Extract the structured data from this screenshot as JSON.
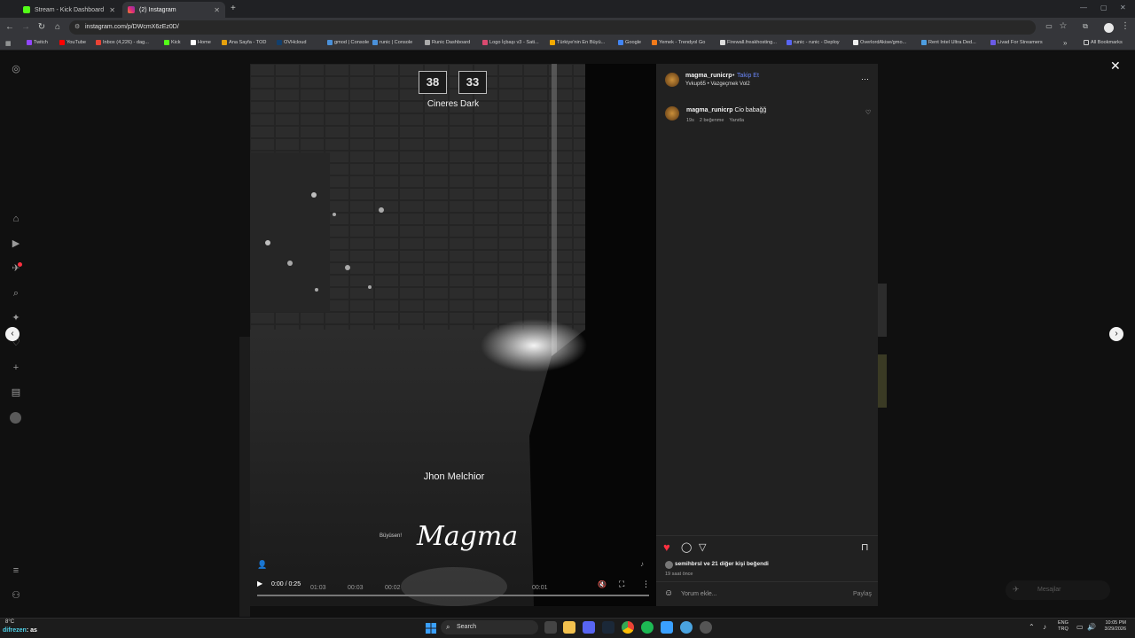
{
  "browser": {
    "tabs": [
      {
        "title": "Stream - Kick Dashboard",
        "active": false,
        "favicon_color": "#53fc18"
      },
      {
        "title": "(2) Instagram",
        "active": true,
        "favicon_color": "#e1306c"
      }
    ],
    "new_tab_label": "+",
    "url": "instagram.com/p/DWcmX6zEz0D/",
    "bookmarks": [
      {
        "label": "Twitch",
        "color": "#9146ff"
      },
      {
        "label": "YouTube",
        "color": "#ff0000"
      },
      {
        "label": "Inbox (4,226) - dag...",
        "color": "#ea4335"
      },
      {
        "label": "Kick",
        "color": "#53fc18"
      },
      {
        "label": "Home",
        "color": "#ffffff"
      },
      {
        "label": "Ana Sayfa - TOD",
        "color": "#e5a00d"
      },
      {
        "label": "OVHcloud",
        "color": "#123f6d"
      },
      {
        "label": "gmod | Console",
        "color": "#4a90d9"
      },
      {
        "label": "runic | Console",
        "color": "#4a90d9"
      },
      {
        "label": "Runic Dashboard",
        "color": "#aaaaaa"
      },
      {
        "label": "Logo İçbaşı v3 - Sati...",
        "color": "#d94a6f"
      },
      {
        "label": "Türkiye'nin En Büyü...",
        "color": "#f2a900"
      },
      {
        "label": "Google",
        "color": "#4285f4"
      },
      {
        "label": "Yemek - Trendyol Go",
        "color": "#f27a1a"
      },
      {
        "label": "Firewall.freakhosting...",
        "color": "#dddddd"
      },
      {
        "label": "runic - runic - Deploy",
        "color": "#5865f2"
      },
      {
        "label": "OverlordAkise/gmo...",
        "color": "#eeeeee"
      },
      {
        "label": "Rent Intel Ultra Ded...",
        "color": "#4d9de0"
      },
      {
        "label": "Livad For Streamers",
        "color": "#6b5be6"
      }
    ],
    "all_bookmarks_label": "All Bookmarks"
  },
  "post": {
    "author": "magma_runicrp",
    "follow_label": "Takip Et",
    "subtitle": "Yvkup65 • Vazgeçmek Vol2",
    "comment_author": "magma_runicrp",
    "comment_text": "Cio babağğ",
    "comment_time": "19s",
    "comment_likes": "2 beğenme",
    "comment_reply": "Yanıtla",
    "likes_user": "semihbrsl",
    "likes_text": " ve 21 diğer kişi beğendi",
    "time_ago": "19 saat önce",
    "comment_placeholder": "Yorum ekle...",
    "share_label": "Paylaş"
  },
  "video": {
    "score_left": "38",
    "score_right": "33",
    "team_label": "Cineres Dark",
    "player_name": "Jhon Melchior",
    "watermark": "Magma",
    "small_caption": "Büyüsen!",
    "time": "0:00 / 0:25",
    "progress": 0.0,
    "timeline_marks": [
      "01:03",
      "00:03",
      "00:02",
      "00:01"
    ]
  },
  "page_overlay": {
    "messages_label": "Mesajlar"
  },
  "taskbar": {
    "weather": "8°C",
    "user_tag": "difrezen",
    "user_suffix": ": as",
    "search_placeholder": "Search",
    "lang": "ENG",
    "lang2": "TRQ",
    "time": "10:05 PM",
    "date": "3/29/2026"
  }
}
